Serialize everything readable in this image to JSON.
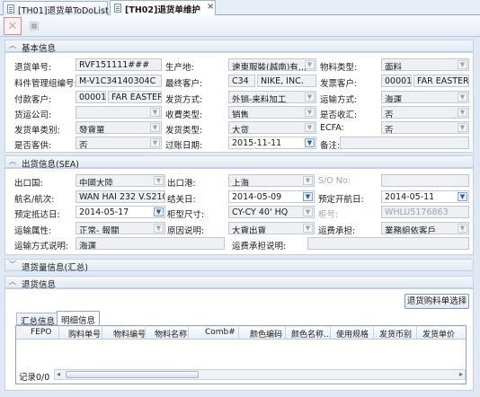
{
  "tabs": [
    {
      "label": "[TH01]退货单ToDoList"
    },
    {
      "label": "[TH02]退货单维护"
    }
  ],
  "toolbar": {
    "delete_icon": "✕",
    "save_icon": "💾"
  },
  "basic": {
    "title": "基本信息",
    "return_no_label": "退货单号:",
    "return_no": "RVF151111###",
    "origin_label": "生产地:",
    "origin": "速東服裝(越南)有...",
    "material_type_label": "物料类型:",
    "material_type": "面料",
    "mgmt_group_label": "料件管理组编号:",
    "mgmt_group": "M-V1C34140304C",
    "final_cust_label": "最终客户:",
    "final_cust_code": "C34",
    "final_cust_name": "NIKE, INC.",
    "invoice_cust_label": "发票客户:",
    "invoice_cust_code": "00001(",
    "invoice_cust_name": "FAR EASTERN",
    "payer_label": "付款客户:",
    "payer_code": "00001(",
    "payer_name": "FAR EASTERN",
    "ship_method_label": "发货方式:",
    "ship_method": "外销-来料加工",
    "transport_label": "运输方式:",
    "transport": "海運",
    "freight_co_label": "货运公司:",
    "freight_co": "",
    "recv_type_label": "收費类型:",
    "recv_type": "销售",
    "collect_label": "是否收汇:",
    "collect": "否",
    "doc_type_label": "发货单类别:",
    "doc_type": "發貨單",
    "goods_type_label": "发货类型:",
    "goods_type": "大货",
    "ecfa_label": "ECFA:",
    "ecfa": "否",
    "supply_label": "是否客供:",
    "supply": "否",
    "post_date_label": "过账日期:",
    "post_date": "2015-11-11",
    "remark_label": "备注:",
    "remark": ""
  },
  "shipping": {
    "title": "出货信息(SEA)",
    "export_country_label": "出口国:",
    "export_country": "中國大陸",
    "export_port_label": "出口港:",
    "export_port": "上海",
    "so_label": "S/O No:",
    "so": "",
    "vessel_label": "航名/航次:",
    "vessel": "WAN HAI 232 V.S210",
    "customs_label": "结关日:",
    "customs_date": "2014-05-09",
    "sail_label": "预定开航日:",
    "sail_date": "2014-05-11",
    "arrival_label": "预定抵达日:",
    "arrival_date": "2014-05-17",
    "container_label": "柜型尺寸:",
    "container": "CY-CY 40' HQ",
    "cabinet_label": "柜号:",
    "cabinet": "WHLU5176863",
    "transport_attr_label": "运输属性:",
    "transport_attr": "正常- 報關",
    "reason_label": "原因说明:",
    "reason": "大貨出貨",
    "freight_bear_label": "运费承担:",
    "freight_bear": "業務組依客戶",
    "transport_desc_label": "运输方式说明:",
    "transport_desc": "海運",
    "freight_desc_label": "运费承担说明:",
    "freight_desc": ""
  },
  "qty_section": {
    "title": "退货量信息(汇总)"
  },
  "return_section": {
    "title": "退货信息",
    "select_button": "退货购料单选择",
    "tab_summary": "汇总信息",
    "tab_detail": "明细信息",
    "columns": [
      "FEPO",
      "购料单号",
      "物料编号",
      "物料名称",
      "Comb#",
      "颜色编码",
      "颜色名称...",
      "使用规格",
      "发货币别",
      "发货单价"
    ],
    "record_label": "记录0/0"
  }
}
